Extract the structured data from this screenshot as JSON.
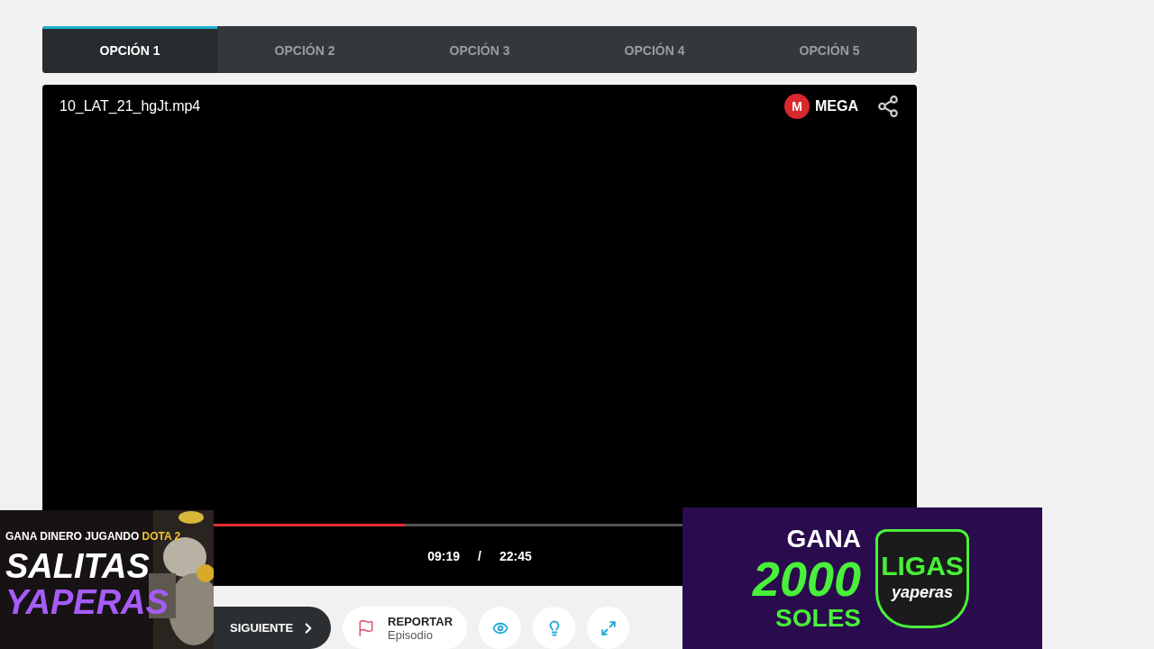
{
  "tabs": [
    {
      "label": "OPCIÓN 1",
      "selected": true
    },
    {
      "label": "OPCIÓN 2",
      "selected": false
    },
    {
      "label": "OPCIÓN 3",
      "selected": false
    },
    {
      "label": "OPCIÓN 4",
      "selected": false
    },
    {
      "label": "OPCIÓN 5",
      "selected": false
    }
  ],
  "player": {
    "filename": "10_LAT_21_hgJt.mp4",
    "host": "MEGA",
    "host_mark": "M",
    "progress": {
      "level": 0.41
    },
    "current_time": "09:19",
    "separator": "/",
    "duration": "22:45"
  },
  "actions": {
    "next": "SIGUIENTE",
    "report_title": "REPORTAR",
    "report_subtitle": "Episodio"
  },
  "ad_left": {
    "tagline": "GANA DINERO JUGANDO",
    "tagline_highlight": "DOTA 2",
    "line_1": "SALITAS",
    "line_2": "YAPERAS"
  },
  "ad_right": {
    "line_1": "GANA",
    "amount": "2000",
    "line_3": "SOLES",
    "logo_top": "LIGAS",
    "logo_bottom": "yaperas"
  }
}
